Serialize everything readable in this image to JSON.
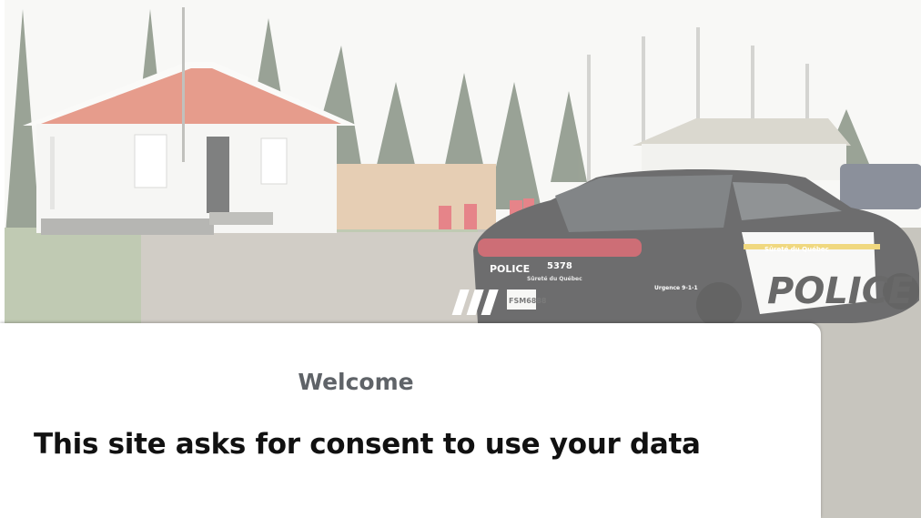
{
  "background_image": {
    "description_icon": "photo-background-icon",
    "car_plate": "FSM6888",
    "car_unit_number": "5378",
    "car_door_text": "POLICE",
    "car_rear_text": "POLICE",
    "car_agency_text": "Sûreté du Québec",
    "car_phone_text": "Urgence 9-1-1"
  },
  "consent": {
    "welcome": "Welcome",
    "headline": "This site asks for consent to use your data"
  },
  "colors": {
    "dialog_bg": "#ffffff",
    "welcome_text": "#5f6368",
    "headline_text": "#111111"
  }
}
